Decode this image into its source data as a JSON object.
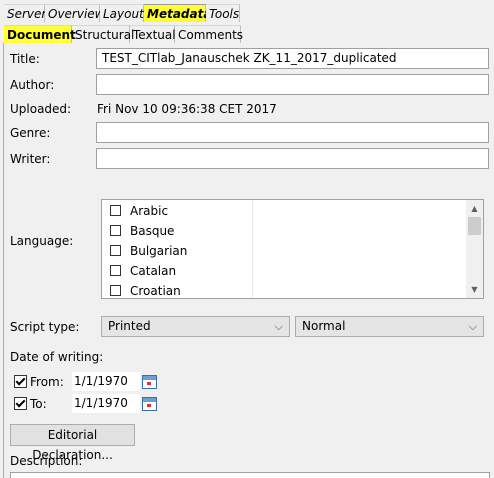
{
  "top_tabs": [
    "Server",
    "Overview",
    "Layout",
    "Metadata",
    "Tools"
  ],
  "sub_tabs": [
    "Document",
    "Structural",
    "Textual",
    "Comments"
  ],
  "fields": {
    "title_label": "Title:",
    "title_value": "TEST_CITlab_Janauschek ZK_11_2017_duplicated",
    "author_label": "Author:",
    "author_value": "",
    "uploaded_label": "Uploaded:",
    "uploaded_value": "Fri Nov 10 09:36:38 CET 2017",
    "genre_label": "Genre:",
    "genre_value": "",
    "writer_label": "Writer:",
    "writer_value": ""
  },
  "language": {
    "label": "Language:",
    "items": [
      "Arabic",
      "Basque",
      "Bulgarian",
      "Catalan",
      "Croatian"
    ]
  },
  "script_type": {
    "label": "Script type:",
    "value1": "Printed",
    "value2": "Normal"
  },
  "date_of_writing": {
    "label": "Date of writing:",
    "from_label": "From:",
    "from_value": "1/1/1970",
    "from_checked": true,
    "to_label": "To:",
    "to_value": "1/1/1970",
    "to_checked": true
  },
  "editorial_button": "Editorial Declaration...",
  "description_label": "Description:",
  "colors": {
    "highlight": "#ffff33"
  }
}
